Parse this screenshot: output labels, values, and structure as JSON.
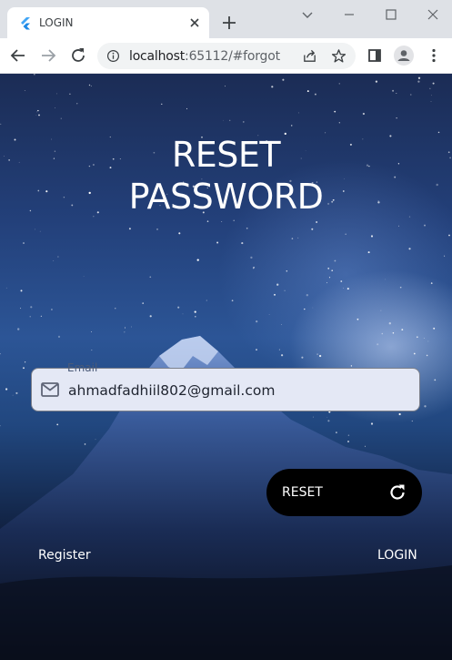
{
  "browser": {
    "tab_title": "LOGIN",
    "url_host": "localhost",
    "url_rest": ":65112/#forgot"
  },
  "page": {
    "title_line1": "RESET",
    "title_line2": "PASSWORD",
    "email": {
      "label": "Email",
      "value": "ahmadfadhiil802@gmail.com"
    },
    "reset_button_label": "RESET",
    "register_link": "Register",
    "login_link": "LOGIN"
  },
  "colors": {
    "button_bg": "#000000",
    "field_bg": "#e4e8f5",
    "text_light": "#ffffff"
  },
  "icons": {
    "favicon": "flutter-icon",
    "email_field": "mail-icon",
    "reset_button": "refresh-icon"
  }
}
